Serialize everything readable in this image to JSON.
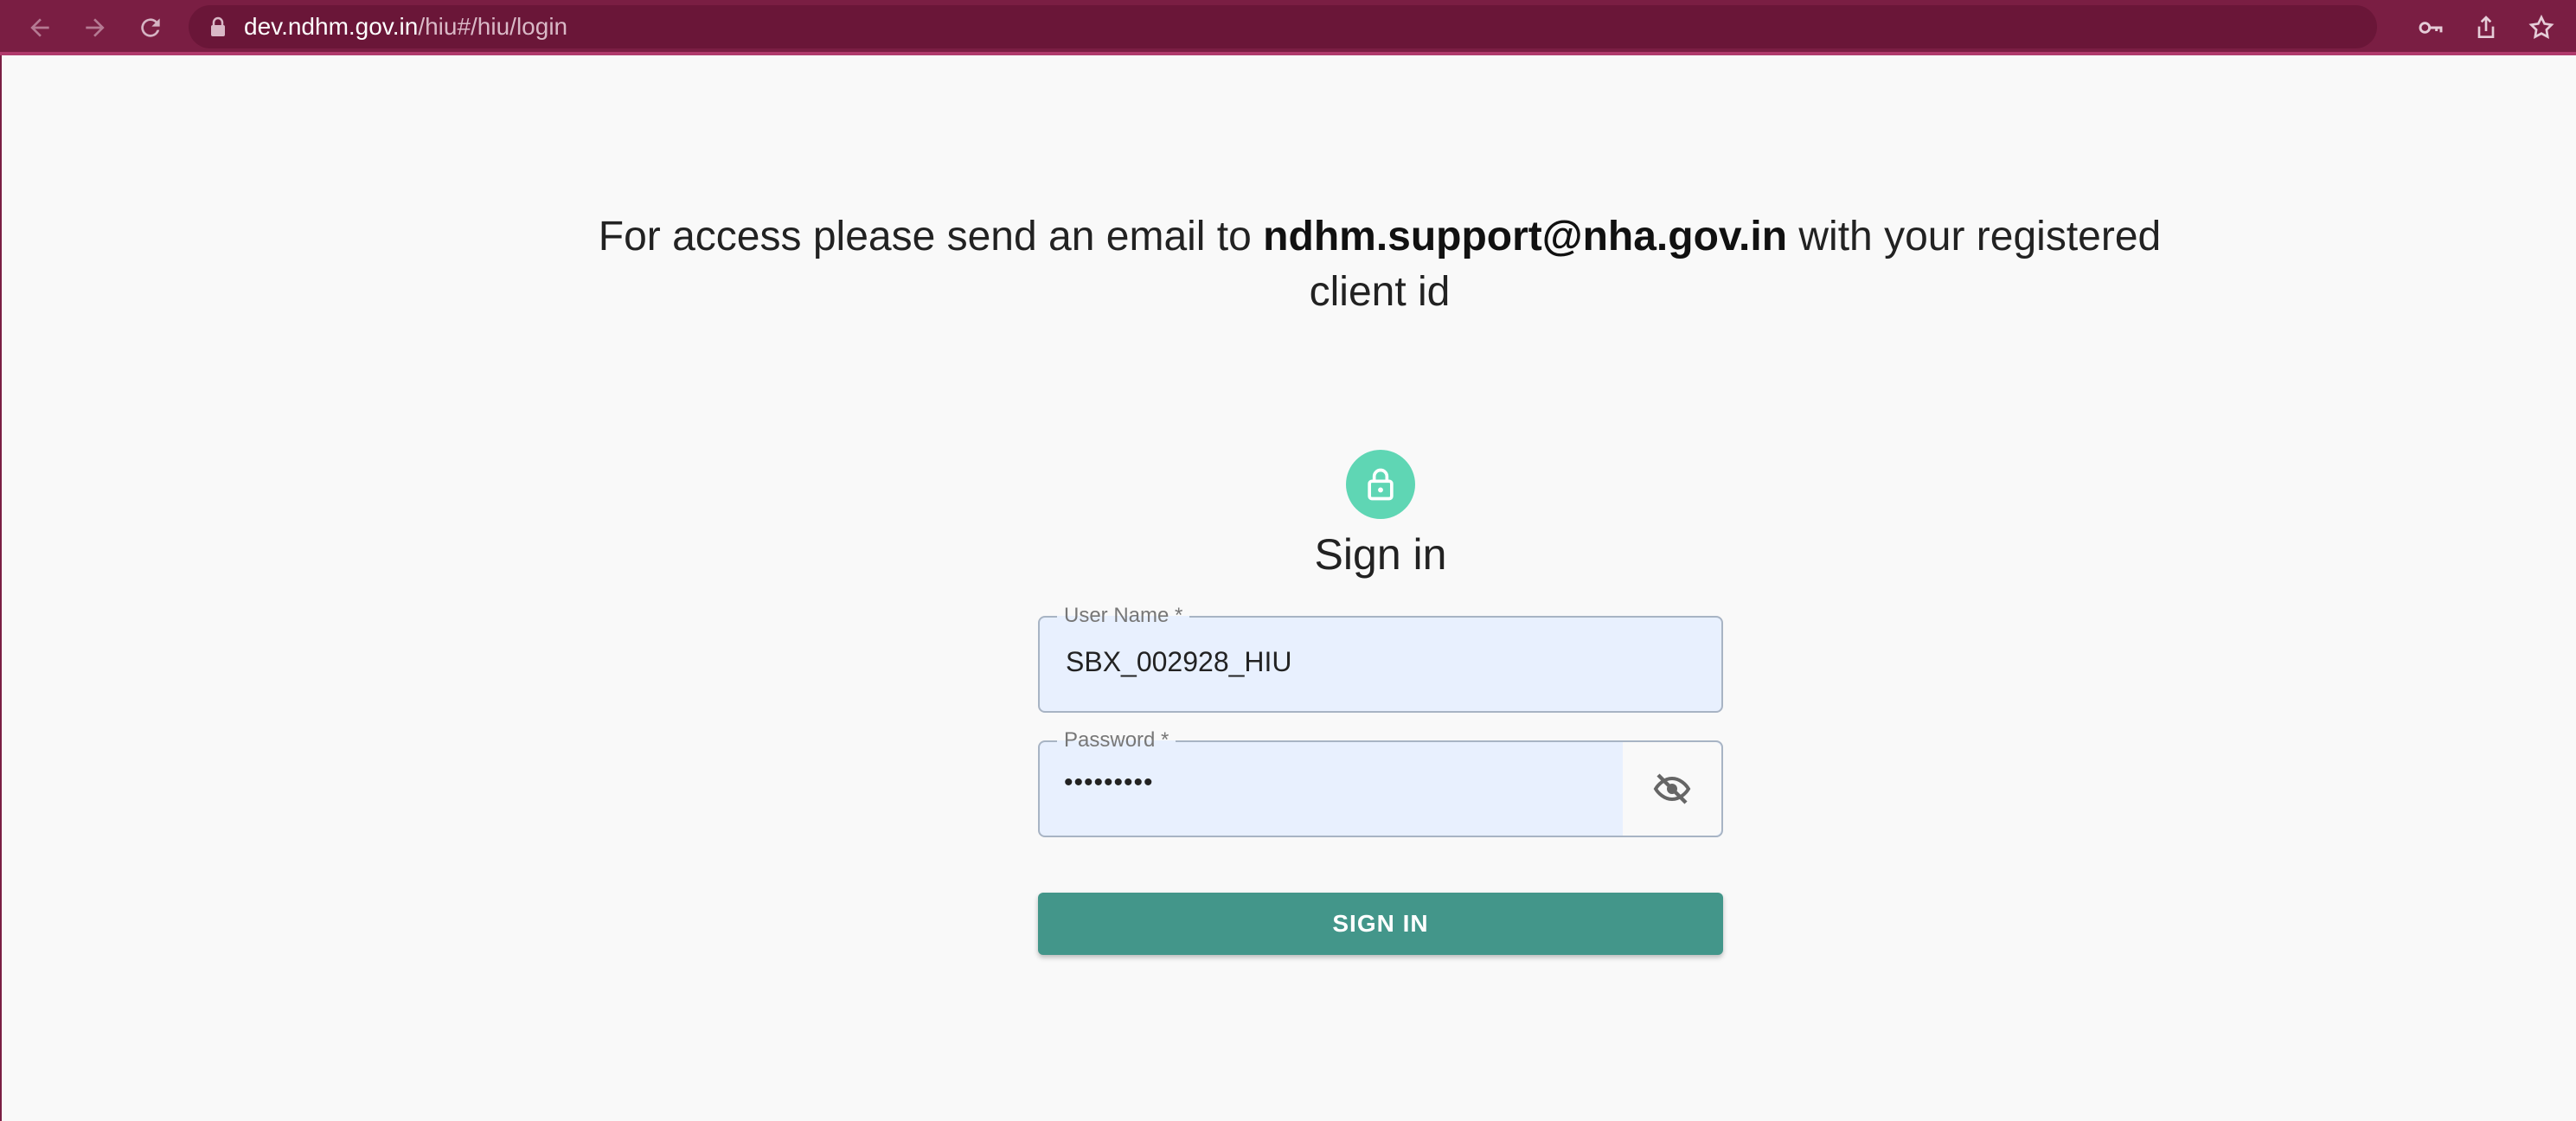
{
  "browser": {
    "url_host": "dev.ndhm.gov.in",
    "url_path": "/hiu#/hiu/login",
    "icons": [
      "back-arrow-icon",
      "forward-arrow-icon",
      "reload-icon",
      "lock-icon",
      "key-icon",
      "share-icon",
      "star-icon"
    ]
  },
  "notice": {
    "prefix": "For access please send an email to ",
    "email": "ndhm.support@nha.gov.in",
    "suffix": " with your registered client id"
  },
  "login": {
    "title": "Sign in",
    "username_label": "User Name *",
    "username_value": "SBX_002928_HIU",
    "password_label": "Password *",
    "password_value": "•••••••••",
    "submit_label": "SIGN IN"
  },
  "colors": {
    "browser_bar": "#7a1e43",
    "accent": "#43968a",
    "avatar": "#5fd6b4",
    "field_bg": "#e8f0fe"
  }
}
